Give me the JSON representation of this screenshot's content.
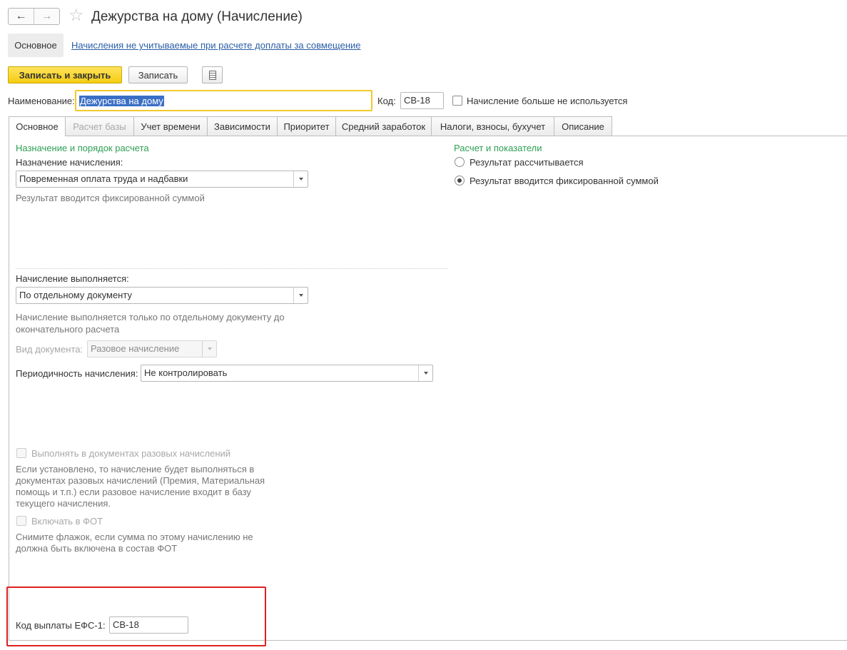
{
  "header": {
    "title": "Дежурства на дому (Начисление)",
    "back_icon": "arrow-left-icon",
    "forward_icon": "arrow-right-icon",
    "favorite_icon": "star-outline-icon"
  },
  "top_nav": {
    "main": "Основное",
    "link": "Начисления не учитываемые при расчете доплаты за совмещение"
  },
  "toolbar": {
    "save_close_label": "Записать и закрыть",
    "save_label": "Записать",
    "more_icon": "document-list-icon"
  },
  "form": {
    "name_label": "Наименование:",
    "name_value": "Дежурства на дому",
    "code_label": "Код:",
    "code_value": "СВ-18",
    "unused_label": "Начисление больше не используется"
  },
  "tabs": [
    {
      "label": "Основное",
      "state": "active"
    },
    {
      "label": "Расчет базы",
      "state": "disabled"
    },
    {
      "label": "Учет времени",
      "state": "normal"
    },
    {
      "label": "Зависимости",
      "state": "normal"
    },
    {
      "label": "Приоритет",
      "state": "normal"
    },
    {
      "label": "Средний заработок",
      "state": "normal"
    },
    {
      "label": "Налоги, взносы, бухучет",
      "state": "normal"
    },
    {
      "label": "Описание",
      "state": "normal"
    }
  ],
  "left": {
    "section_title": "Назначение и порядок расчета",
    "purpose_label": "Назначение начисления:",
    "purpose_value": "Повременная оплата труда и надбавки",
    "purpose_hint": "Результат вводится фиксированной суммой",
    "execution_label": "Начисление выполняется:",
    "execution_value": "По отдельному документу",
    "execution_hint_1": "Начисление выполняется только по отдельному документу до",
    "execution_hint_2": "окончательного расчета",
    "doc_type_label": "Вид документа:",
    "doc_type_value": "Разовое начисление",
    "periodicity_label": "Периодичность начисления:",
    "periodicity_value": "Не контролировать",
    "one_time_label": "Выполнять в документах разовых начислений",
    "one_time_hint_1": "Если установлено, то начисление будет выполняться в",
    "one_time_hint_2": "документах разовых начислений (Премия, Материальная",
    "one_time_hint_3": "помощь и т.п.) если разовое начисление входит в базу",
    "one_time_hint_4": "текущего начисления.",
    "fot_label": "Включать в ФОТ",
    "fot_hint_1": "Снимите флажок, если сумма по этому начислению не",
    "fot_hint_2": "должна быть включена в состав ФОТ",
    "efs_label": "Код выплаты ЕФС-1:",
    "efs_value": "СВ-18"
  },
  "right": {
    "section_title": "Расчет и показатели",
    "option_calculated": "Результат рассчитывается",
    "option_fixed": "Результат вводится фиксированной суммой",
    "selected": "option_fixed"
  },
  "colors": {
    "accent_yellow": "#f4cc13",
    "link_blue": "#2a5ea7",
    "section_green": "#2e9f54",
    "highlight_red": "#e02020",
    "selection_blue": "#3b6fc6"
  }
}
